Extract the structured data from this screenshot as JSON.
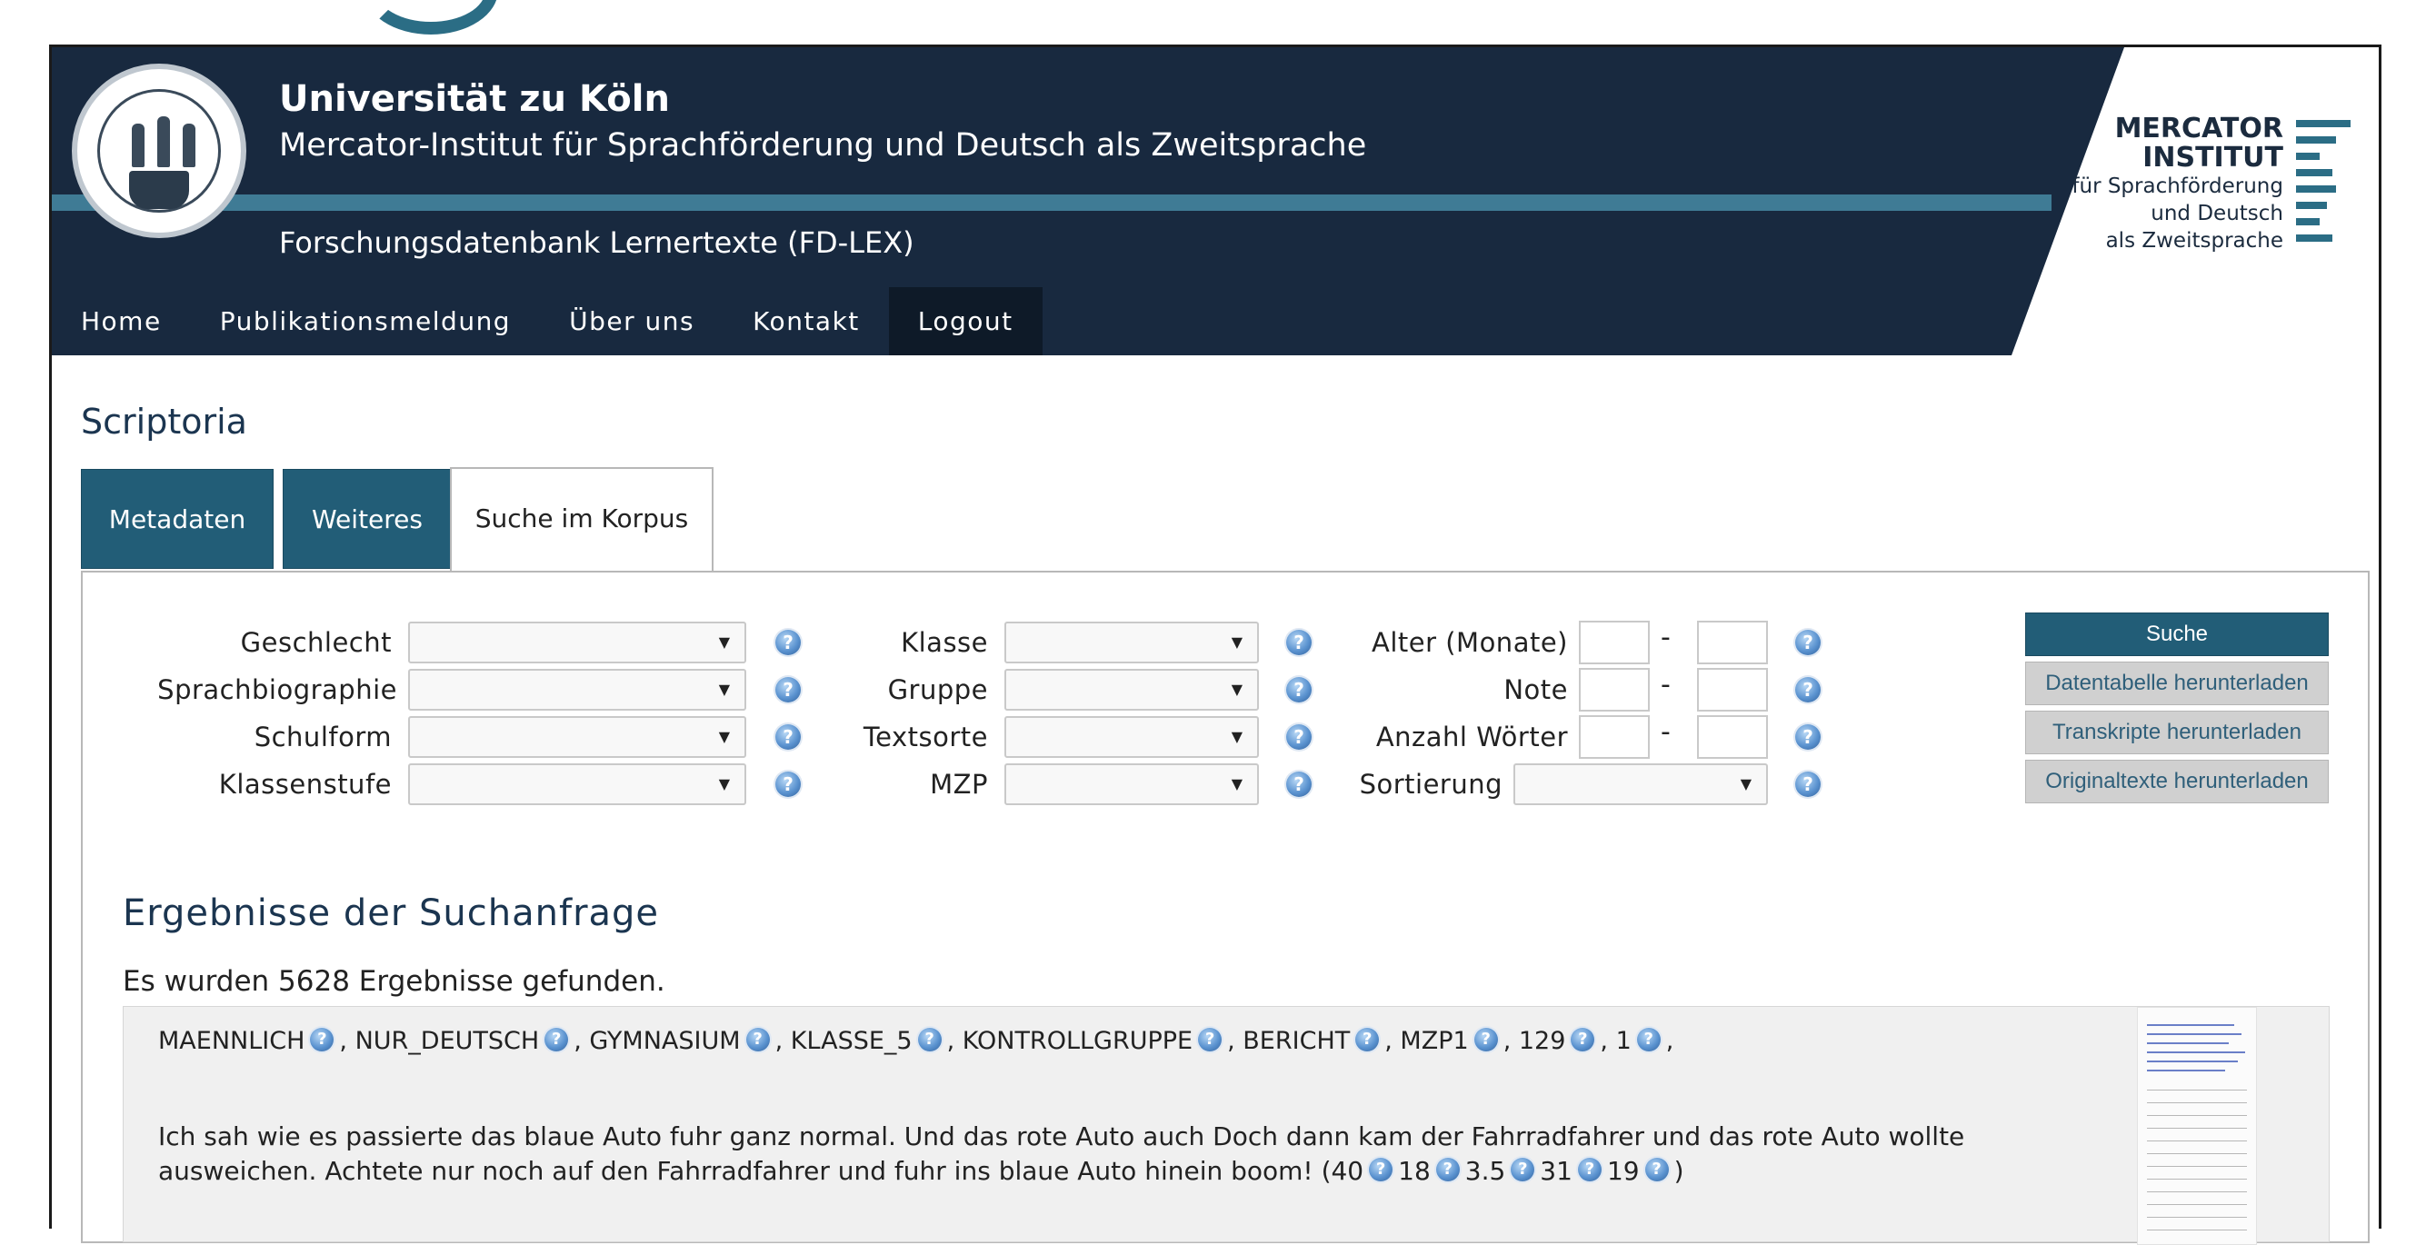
{
  "header": {
    "university": "Universität zu Köln",
    "institute": "Mercator-Institut für Sprachförderung und Deutsch als Zweitsprache",
    "database": "Forschungsdatenbank Lernertexte (FD-LEX)",
    "logo_lines": [
      "MERCATOR",
      "INSTITUT",
      "für Sprachförderung",
      "und Deutsch",
      "als Zweitsprache"
    ]
  },
  "nav": [
    {
      "label": "Home"
    },
    {
      "label": "Publikationsmeldung"
    },
    {
      "label": "Über uns"
    },
    {
      "label": "Kontakt"
    },
    {
      "label": "Logout"
    }
  ],
  "page_title": "Scriptoria",
  "tabs": [
    {
      "label": "Metadaten"
    },
    {
      "label": "Weiteres"
    },
    {
      "label": "Suche im Korpus"
    }
  ],
  "filters": {
    "col1": [
      "Geschlecht",
      "Sprachbiographie",
      "Schulform",
      "Klassenstufe"
    ],
    "col2": [
      "Klasse",
      "Gruppe",
      "Textsorte",
      "MZP"
    ],
    "col3": [
      "Alter (Monate)",
      "Note",
      "Anzahl Wörter",
      "Sortierung"
    ],
    "range_dash": "-",
    "help_glyph": "?"
  },
  "buttons": {
    "search": "Suche",
    "download_table": "Datentabelle herunterladen",
    "download_transcripts": "Transkripte herunterladen",
    "download_originals": "Originaltexte herunterladen"
  },
  "results": {
    "title": "Ergebnisse der Suchanfrage",
    "count_text": "Es wurden 5628 Ergebnisse gefunden.",
    "items": [
      {
        "meta": [
          "MAENNLICH",
          "NUR_DEUTSCH",
          "GYMNASIUM",
          "KLASSE_5",
          "KONTROLLGRUPPE",
          "BERICHT",
          "MZP1",
          "129",
          "1"
        ],
        "text": "Ich sah wie es passierte das blaue Auto fuhr ganz normal. Und das rote Auto auch Doch dann kam der Fahrradfahrer und das rote Auto wollte ausweichen. Achtete nur noch auf den Fahrradfahrer und fuhr ins blaue Auto hinein boom!",
        "scores_open": "(40",
        "scores": [
          "18",
          "3.5",
          "31",
          "19"
        ],
        "scores_close": ")"
      }
    ]
  },
  "colors": {
    "header_bg": "#18293f",
    "accent": "#2b6d85",
    "button_primary": "#225d77",
    "button_secondary": "#d0d0d0"
  },
  "icons": [
    "university-seal-icon",
    "help-icon",
    "chevron-down-icon"
  ]
}
